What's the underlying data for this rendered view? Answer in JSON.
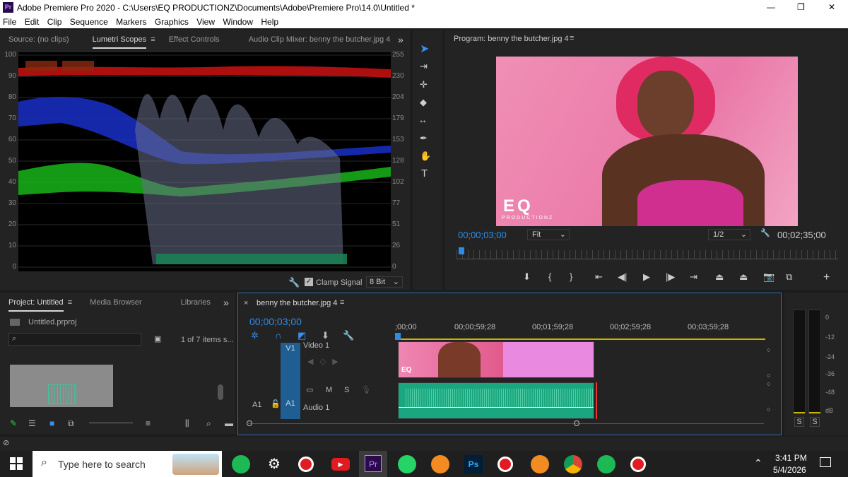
{
  "window": {
    "title": "Adobe Premiere Pro 2020 - C:\\Users\\EQ PRODUCTIONZ\\Documents\\Adobe\\Premiere Pro\\14.0\\Untitled *",
    "app_badge": "Pr",
    "minimize": "—",
    "maximize": "❐",
    "close": "✕"
  },
  "menu": [
    "File",
    "Edit",
    "Clip",
    "Sequence",
    "Markers",
    "Graphics",
    "View",
    "Window",
    "Help"
  ],
  "source_panel": {
    "tabs": [
      "Source: (no clips)",
      "Lumetri Scopes",
      "Effect Controls",
      "Audio Clip Mixer: benny the butcher.jpg 4"
    ],
    "overflow": "»",
    "left_scale": [
      "100",
      "90",
      "80",
      "70",
      "60",
      "50",
      "40",
      "30",
      "20",
      "10",
      "0"
    ],
    "right_scale": [
      "255",
      "230",
      "204",
      "179",
      "153",
      "128",
      "102",
      "77",
      "51",
      "26",
      "0"
    ],
    "clamp_label": "Clamp Signal",
    "bit_depth": "8 Bit"
  },
  "program": {
    "title": "Program: benny the butcher.jpg 4",
    "timecode": "00;00;03;00",
    "fit": "Fit",
    "resolution": "1/2",
    "duration": "00;02;35;00",
    "watermark_top": "EQ",
    "watermark_bottom": "PRODUCTIONZ"
  },
  "project": {
    "tabs": [
      "Project: Untitled",
      "Media Browser",
      "Libraries"
    ],
    "file": "Untitled.prproj",
    "items": "1 of 7 items s...",
    "search_placeholder": ""
  },
  "timeline": {
    "tab": "benny the butcher.jpg 4",
    "timecode": "00;00;03;00",
    "ruler": [
      ";00;00",
      "00;00;59;28",
      "00;01;59;28",
      "00;02;59;28",
      "00;03;59;28"
    ],
    "v1": "V1",
    "video1": "Video 1",
    "a1": "A1",
    "audio1": "Audio 1",
    "m": "M",
    "s": "S"
  },
  "meter": {
    "scale": [
      "0",
      "-12",
      "-24",
      "-36",
      "-48",
      "dB"
    ],
    "solo": [
      "S",
      "S"
    ]
  },
  "taskbar": {
    "search": "Type here to search",
    "time": "3:41 PM",
    "date": "5/4/2026",
    "ps": "Ps",
    "pr": "Pr"
  }
}
